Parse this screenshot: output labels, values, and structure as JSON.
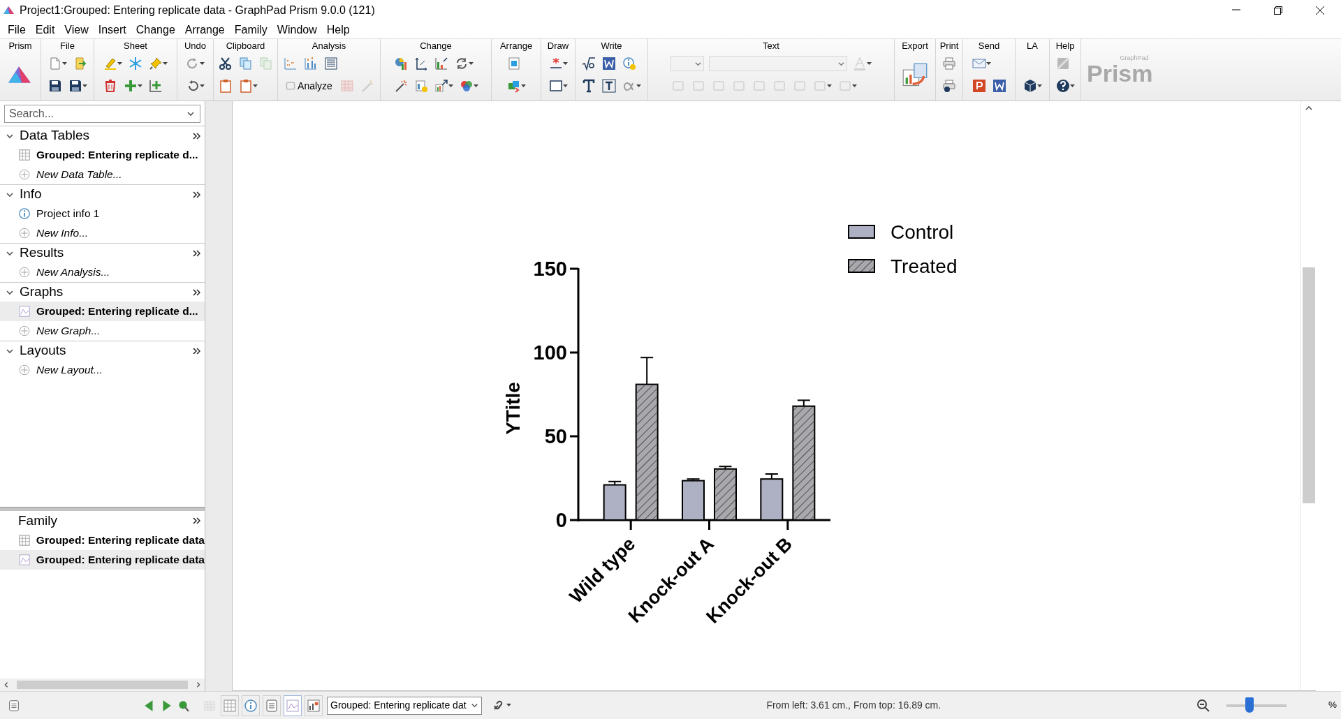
{
  "window": {
    "title": "Project1:Grouped: Entering replicate data - GraphPad Prism 9.0.0 (121)"
  },
  "menu": [
    "File",
    "Edit",
    "View",
    "Insert",
    "Change",
    "Arrange",
    "Family",
    "Window",
    "Help"
  ],
  "ribbon": {
    "groups": [
      {
        "label": "Prism",
        "disabled": false
      },
      {
        "label": "File",
        "disabled": false
      },
      {
        "label": "Sheet",
        "disabled": false
      },
      {
        "label": "Undo",
        "disabled": false
      },
      {
        "label": "Clipboard",
        "disabled": false
      },
      {
        "label": "Analysis",
        "disabled": false
      },
      {
        "label": "Change",
        "disabled": false
      },
      {
        "label": "Arrange",
        "disabled": false
      },
      {
        "label": "Draw",
        "disabled": false
      },
      {
        "label": "Write",
        "disabled": false
      },
      {
        "label": "Text",
        "disabled": true
      },
      {
        "label": "Export",
        "disabled": false
      },
      {
        "label": "Print",
        "disabled": false
      },
      {
        "label": "Send",
        "disabled": false
      },
      {
        "label": "LA",
        "disabled": false
      },
      {
        "label": "Help",
        "disabled": false
      }
    ],
    "analyze_button": "Analyze",
    "brand": {
      "small": "GraphPad",
      "large": "Prism"
    }
  },
  "sidebar": {
    "search": {
      "placeholder": "Search..."
    },
    "sections": [
      {
        "label": "Data Tables",
        "expanded": true,
        "items": [
          {
            "kind": "table",
            "label": "Grouped: Entering replicate d...",
            "selected": false
          },
          {
            "kind": "add",
            "label": "New Data Table...",
            "selected": false
          }
        ]
      },
      {
        "label": "Info",
        "expanded": true,
        "items": [
          {
            "kind": "info",
            "label": "Project info 1",
            "selected": false
          },
          {
            "kind": "add",
            "label": "New Info...",
            "selected": false
          }
        ]
      },
      {
        "label": "Results",
        "expanded": true,
        "items": [
          {
            "kind": "add",
            "label": "New Analysis...",
            "selected": false
          }
        ]
      },
      {
        "label": "Graphs",
        "expanded": true,
        "items": [
          {
            "kind": "graph",
            "label": "Grouped: Entering replicate d...",
            "selected": true
          },
          {
            "kind": "add",
            "label": "New Graph...",
            "selected": false
          }
        ]
      },
      {
        "label": "Layouts",
        "expanded": true,
        "items": [
          {
            "kind": "add",
            "label": "New Layout...",
            "selected": false
          }
        ]
      }
    ],
    "family": {
      "label": "Family",
      "items": [
        {
          "kind": "table",
          "label": "Grouped: Entering replicate data",
          "selected": false
        },
        {
          "kind": "graph",
          "label": "Grouped: Entering replicate data",
          "selected": true
        }
      ]
    }
  },
  "graph": {
    "chart_data": {
      "type": "bar",
      "ylabel": "YTitle",
      "categories": [
        "Wild type",
        "Knock-out A",
        "Knock-out B"
      ],
      "series": [
        {
          "name": "Control",
          "color": "#aeb1c4",
          "values": [
            21,
            23.5,
            24.5
          ],
          "errors": [
            2,
            1,
            3
          ]
        },
        {
          "name": "Treated",
          "color": "#a9a9ad",
          "values": [
            81,
            30.5,
            68
          ],
          "errors": [
            16,
            1.5,
            3.5
          ]
        }
      ],
      "ylim": [
        0,
        150
      ],
      "yticks": [
        0,
        50,
        100,
        150
      ],
      "legend": "upper right"
    }
  },
  "status_bar": {
    "sheet_buttons": [
      {
        "selected": false
      },
      {
        "selected": false
      },
      {
        "selected": false
      },
      {
        "selected": true
      },
      {
        "selected": false
      }
    ],
    "sheet_select": {
      "value": "Grouped: Entering replicate dat"
    },
    "position": "From left: 3.61 cm., From top: 16.89 cm.",
    "zoom": {
      "level": 0.38,
      "text": "%"
    }
  }
}
